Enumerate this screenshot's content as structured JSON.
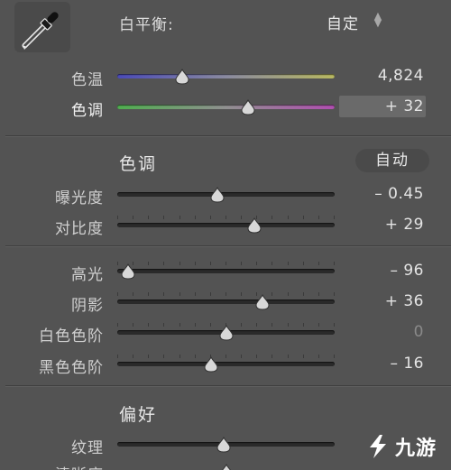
{
  "white_balance": {
    "label": "白平衡:",
    "mode": "自定",
    "temp": {
      "label": "色温",
      "value": "4,824",
      "fraction": 0.3
    },
    "tint": {
      "label": "色调",
      "value": "+ 32",
      "fraction": 0.6
    }
  },
  "tone": {
    "title": "色调",
    "auto_label": "自动",
    "exposure": {
      "label": "曝光度",
      "value": "– 0.45",
      "fraction": 0.46
    },
    "contrast": {
      "label": "对比度",
      "value": "+ 29",
      "fraction": 0.63
    },
    "highlights": {
      "label": "高光",
      "value": "– 96",
      "fraction": 0.05
    },
    "shadows": {
      "label": "阴影",
      "value": "+ 36",
      "fraction": 0.67
    },
    "whites": {
      "label": "白色色阶",
      "value": "0",
      "fraction": 0.5
    },
    "blacks": {
      "label": "黑色色阶",
      "value": "– 16",
      "fraction": 0.43
    }
  },
  "presence": {
    "title": "偏好",
    "texture": {
      "label": "纹理",
      "fraction": 0.49
    },
    "clarity": {
      "label": "清晰度",
      "fraction": 0.5
    }
  },
  "watermark": {
    "text": "九游",
    "brand_color": "#ffffff"
  },
  "colors": {
    "background": "#535353",
    "track": "#2a2a2a",
    "thumb": "#d8d8d8"
  }
}
